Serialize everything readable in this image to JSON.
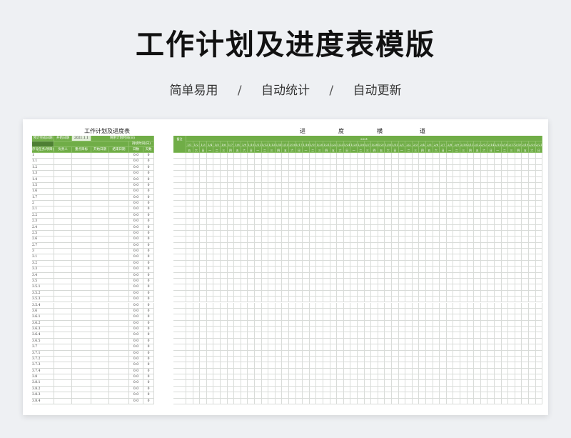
{
  "hero": {
    "title": "工作计划及进度表模版",
    "features": [
      "简单易用",
      "自动统计",
      "自动更新"
    ],
    "separator": "/"
  },
  "sheet": {
    "title": "工作计划及进度表",
    "gantt_title_chars": [
      "进",
      "度",
      "横",
      "道"
    ],
    "header_row1": {
      "plan_date_label": "预计完成日期",
      "start_date_label": "开始日期",
      "start_date_value": "2021.1.1",
      "remaining_label": "剩余计划时间(日)"
    },
    "header_row2_sub": "持续时间(日)",
    "columns": [
      "序号",
      "任务/项目名称",
      "负责人",
      "重点目标",
      "开始日期",
      "结束日期",
      "日数",
      "天数"
    ],
    "year_label": "2021",
    "status_label": "备注",
    "day_labels": [
      "1/1",
      "1/2",
      "1/3",
      "1/4",
      "1/5",
      "1/6",
      "1/7",
      "1/8",
      "1/9",
      "1/10",
      "1/11",
      "1/12",
      "1/13",
      "1/14",
      "1/15",
      "1/16",
      "1/17",
      "1/18",
      "1/19",
      "1/20",
      "1/21",
      "1/22",
      "1/23",
      "1/24",
      "1/25",
      "1/26",
      "1/27",
      "1/28",
      "1/29",
      "1/30",
      "1/31",
      "2/1",
      "2/2",
      "2/3",
      "2/4",
      "2/5",
      "2/6",
      "2/7",
      "2/8",
      "2/9",
      "2/10",
      "2/11",
      "2/12",
      "2/13",
      "2/14",
      "2/15",
      "2/16",
      "2/17",
      "2/18",
      "2/19",
      "2/20",
      "2/21"
    ],
    "weekday_labels": [
      "五",
      "六",
      "日",
      "一",
      "二",
      "三",
      "四",
      "五",
      "六",
      "日",
      "一",
      "二",
      "三",
      "四",
      "五",
      "六",
      "日",
      "一",
      "二",
      "三",
      "四",
      "五",
      "六",
      "日",
      "一",
      "二",
      "三",
      "四",
      "五",
      "六",
      "日",
      "一",
      "二",
      "三",
      "四",
      "五",
      "六",
      "日",
      "一",
      "二",
      "三",
      "四",
      "五",
      "六",
      "日",
      "一",
      "二",
      "三",
      "四",
      "五",
      "六",
      "日"
    ],
    "rows": [
      "1",
      "1.1",
      "1.2",
      "1.3",
      "1.4",
      "1.5",
      "1.6",
      "1.7",
      "2",
      "2.1",
      "2.2",
      "2.3",
      "2.4",
      "2.5",
      "2.6",
      "2.7",
      "3",
      "3.1",
      "3.2",
      "3.3",
      "3.4",
      "3.5",
      "3.5.1",
      "3.5.2",
      "3.5.3",
      "3.5.4",
      "3.6",
      "3.6.1",
      "3.6.2",
      "3.6.3",
      "3.6.4",
      "3.6.5",
      "3.7",
      "3.7.1",
      "3.7.2",
      "3.7.3",
      "3.7.4",
      "3.8",
      "3.8.1",
      "3.8.2",
      "3.8.3",
      "3.8.4"
    ],
    "row_days": "0.0",
    "row_count": "0"
  }
}
